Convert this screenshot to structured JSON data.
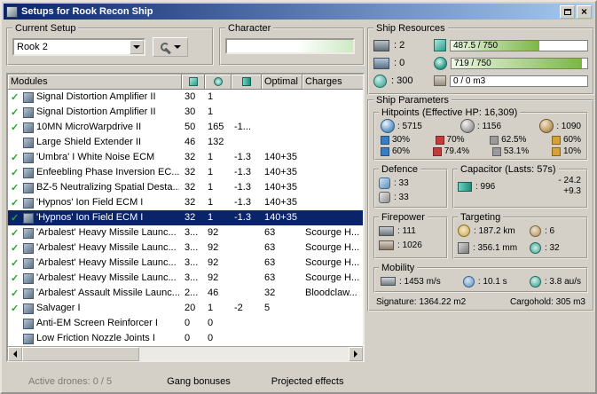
{
  "colors": {
    "window_bg": "#d4d0c8",
    "title_left": "#0a246a",
    "title_right": "#a6caf0",
    "selection": "#0a246a",
    "check": "#2da32d",
    "bar_green": "#7ab648",
    "em": "#3b7dc4",
    "thermal": "#c43b3b",
    "kinetic": "#9a9a9a",
    "explosive": "#d8a23a"
  },
  "icons": {
    "check_glyph": "✓",
    "names": [
      "app-icon",
      "maximize-icon",
      "close-icon",
      "tools-icon",
      "dropdown-arrow-icon",
      "cpu-icon",
      "powergrid-icon",
      "capacitor-usage-icon",
      "module-icon",
      "active-check-icon",
      "turret-slot-icon",
      "launcher-slot-icon",
      "calibration-icon",
      "cargo-icon",
      "shield-icon",
      "armor-icon",
      "structure-icon",
      "em-resist-icon",
      "thermal-resist-icon",
      "kinetic-resist-icon",
      "explosive-resist-icon",
      "shield-defence-icon",
      "armor-defence-icon",
      "capacitor-icon",
      "volley-icon",
      "dps-icon",
      "targeting-range-icon",
      "max-targets-icon",
      "scan-resolution-icon",
      "sensor-strength-icon",
      "speed-icon",
      "align-time-icon",
      "warp-speed-icon",
      "scroll-left-icon",
      "scroll-right-icon"
    ]
  },
  "window": {
    "title": "Setups for Rook Recon Ship"
  },
  "left": {
    "current_setup": {
      "label": "Current Setup",
      "value": "Rook 2"
    },
    "character": {
      "label": "Character",
      "value": ""
    },
    "table": {
      "headers": {
        "modules": "Modules",
        "optimal": "Optimal",
        "charges": "Charges"
      },
      "rows": [
        {
          "check": true,
          "selected": false,
          "name": "Signal Distortion Amplifier II",
          "cpu": "30",
          "pg": "1",
          "cap": "",
          "optimal": "",
          "charges": ""
        },
        {
          "check": true,
          "selected": false,
          "name": "Signal Distortion Amplifier II",
          "cpu": "30",
          "pg": "1",
          "cap": "",
          "optimal": "",
          "charges": ""
        },
        {
          "check": true,
          "selected": false,
          "name": "10MN MicroWarpdrive II",
          "cpu": "50",
          "pg": "165",
          "cap": "-1...",
          "optimal": "",
          "charges": ""
        },
        {
          "check": false,
          "selected": false,
          "name": "Large Shield Extender II",
          "cpu": "46",
          "pg": "132",
          "cap": "",
          "optimal": "",
          "charges": ""
        },
        {
          "check": true,
          "selected": false,
          "name": "'Umbra' I White Noise ECM",
          "cpu": "32",
          "pg": "1",
          "cap": "-1.3",
          "optimal": "140+35",
          "charges": ""
        },
        {
          "check": true,
          "selected": false,
          "name": "Enfeebling Phase Inversion EC...",
          "cpu": "32",
          "pg": "1",
          "cap": "-1.3",
          "optimal": "140+35",
          "charges": ""
        },
        {
          "check": true,
          "selected": false,
          "name": "BZ-5 Neutralizing Spatial Desta...",
          "cpu": "32",
          "pg": "1",
          "cap": "-1.3",
          "optimal": "140+35",
          "charges": ""
        },
        {
          "check": true,
          "selected": false,
          "name": "'Hypnos' Ion Field ECM I",
          "cpu": "32",
          "pg": "1",
          "cap": "-1.3",
          "optimal": "140+35",
          "charges": ""
        },
        {
          "check": true,
          "selected": true,
          "name": "'Hypnos' Ion Field ECM I",
          "cpu": "32",
          "pg": "1",
          "cap": "-1.3",
          "optimal": "140+35",
          "charges": ""
        },
        {
          "check": true,
          "selected": false,
          "name": "'Arbalest' Heavy Missile Launc...",
          "cpu": "3...",
          "pg": "92",
          "cap": "",
          "optimal": "63",
          "charges": "Scourge H..."
        },
        {
          "check": true,
          "selected": false,
          "name": "'Arbalest' Heavy Missile Launc...",
          "cpu": "3...",
          "pg": "92",
          "cap": "",
          "optimal": "63",
          "charges": "Scourge H..."
        },
        {
          "check": true,
          "selected": false,
          "name": "'Arbalest' Heavy Missile Launc...",
          "cpu": "3...",
          "pg": "92",
          "cap": "",
          "optimal": "63",
          "charges": "Scourge H..."
        },
        {
          "check": true,
          "selected": false,
          "name": "'Arbalest' Heavy Missile Launc...",
          "cpu": "3...",
          "pg": "92",
          "cap": "",
          "optimal": "63",
          "charges": "Scourge H..."
        },
        {
          "check": true,
          "selected": false,
          "name": "'Arbalest' Assault Missile Launc...",
          "cpu": "2...",
          "pg": "46",
          "cap": "",
          "optimal": "32",
          "charges": "Bloodclaw..."
        },
        {
          "check": true,
          "selected": false,
          "name": "Salvager I",
          "cpu": "20",
          "pg": "1",
          "cap": "-2",
          "optimal": "5",
          "charges": ""
        },
        {
          "check": false,
          "selected": false,
          "name": "Anti-EM Screen Reinforcer I",
          "cpu": "0",
          "pg": "0",
          "cap": "",
          "optimal": "",
          "charges": ""
        },
        {
          "check": false,
          "selected": false,
          "name": "Low Friction Nozzle Joints I",
          "cpu": "0",
          "pg": "0",
          "cap": "",
          "optimal": "",
          "charges": ""
        }
      ]
    },
    "footer": {
      "active_drones": "Active drones: 0 / 5",
      "gang_bonuses": "Gang bonuses",
      "projected_effects": "Projected effects"
    }
  },
  "right": {
    "ship_resources": {
      "label": "Ship Resources",
      "slots": [
        {
          "text": ": 2"
        },
        {
          "text": ": 0"
        },
        {
          "text": ": 300"
        }
      ],
      "bars": [
        {
          "text": "487.5 / 750",
          "fill": 65
        },
        {
          "text": "719 / 750",
          "fill": 96
        },
        {
          "text": "0 / 0 m3",
          "fill": 0
        }
      ]
    },
    "ship_parameters": {
      "label": "Ship Parameters",
      "hitpoints": {
        "label": "Hitpoints (Effective HP: 16,309)",
        "hp": [
          {
            "text": ": 5715"
          },
          {
            "text": ": 1156"
          },
          {
            "text": ": 1090"
          }
        ],
        "resists": [
          [
            "30%",
            "70%",
            "62.5%",
            "60%"
          ],
          [
            "60%",
            "79.4%",
            "53.1%",
            "10%"
          ]
        ]
      },
      "defence": {
        "label": "Defence",
        "items": [
          ": 33",
          ": 33"
        ]
      },
      "capacitor": {
        "label": "Capacitor (Lasts: 57s)",
        "amount": ": 996",
        "drain": "- 24.2",
        "peak": "+9.3"
      },
      "firepower": {
        "label": "Firepower",
        "items": [
          ": 111",
          ": 1026"
        ]
      },
      "targeting": {
        "label": "Targeting",
        "items": [
          ": 187.2 km",
          ": 6",
          ": 356.1 mm",
          ": 32"
        ]
      },
      "mobility": {
        "label": "Mobility",
        "items": [
          ": 1453 m/s",
          ": 10.1 s",
          ": 3.8 au/s"
        ]
      },
      "signature": "Signature: 1364.22 m2",
      "cargohold": "Cargohold: 305 m3"
    }
  }
}
